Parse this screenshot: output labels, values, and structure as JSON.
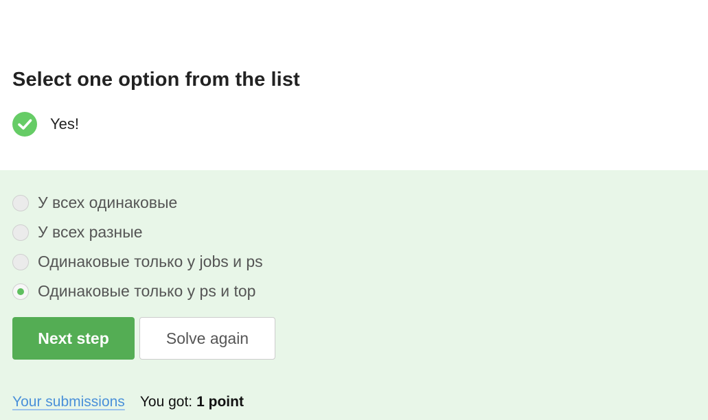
{
  "question": {
    "title": "Select one option from the list"
  },
  "feedback": {
    "icon": "checkmark-icon",
    "text": "Yes!",
    "color": "#66cc66"
  },
  "options": [
    {
      "label": "У всех одинаковые",
      "selected": false
    },
    {
      "label": "У всех разные",
      "selected": false
    },
    {
      "label": "Одинаковые только у jobs и ps",
      "selected": false
    },
    {
      "label": "Одинаковые только у ps и top",
      "selected": true
    }
  ],
  "buttons": {
    "next_label": "Next step",
    "again_label": "Solve again"
  },
  "footer": {
    "submissions_link": "Your submissions",
    "score_prefix": "You got:",
    "score_value": "1 point"
  },
  "colors": {
    "panel_background": "#e8f6e8",
    "primary_button": "#54ad54",
    "link": "#4a90d9"
  }
}
